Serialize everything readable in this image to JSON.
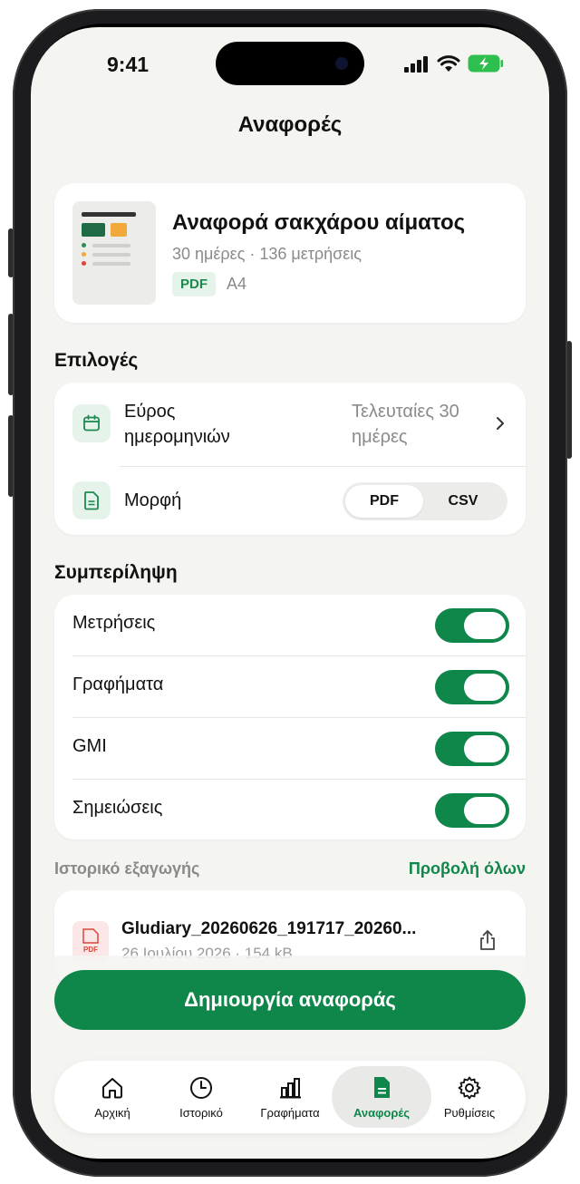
{
  "status_bar": {
    "time": "9:41"
  },
  "header": {
    "title": "Αναφορές"
  },
  "report": {
    "title": "Αναφορά σακχάρου αίματος",
    "meta": "30 ημέρες · 136 μετρήσεις",
    "format_badge": "PDF",
    "paper_size": "A4"
  },
  "options": {
    "heading": "Επιλογές",
    "date_range": {
      "label": "Εύρος ημερομηνιών",
      "value": "Τελευταίες 30 ημέρες",
      "icon": "calendar-icon"
    },
    "format": {
      "label": "Μορφή",
      "icon": "document-icon",
      "options": [
        "PDF",
        "CSV"
      ],
      "selected": "PDF"
    }
  },
  "include": {
    "heading": "Συμπερίληψη",
    "items": [
      {
        "label": "Μετρήσεις",
        "on": true
      },
      {
        "label": "Γραφήματα",
        "on": true
      },
      {
        "label": "GMI",
        "on": true
      },
      {
        "label": "Σημειώσεις",
        "on": true
      }
    ]
  },
  "history": {
    "heading": "Ιστορικό εξαγωγής",
    "view_all": "Προβολή όλων",
    "files": [
      {
        "name": "Gludiary_20260626_191717_20260...",
        "meta": "26 Ιουλίου 2026 · 154 kB",
        "type_label": "PDF"
      }
    ]
  },
  "actions": {
    "create": "Δημιουργία αναφοράς"
  },
  "tabbar": {
    "items": [
      {
        "label": "Αρχική",
        "icon": "home-icon"
      },
      {
        "label": "Ιστορικό",
        "icon": "clock-icon"
      },
      {
        "label": "Γραφήματα",
        "icon": "bar-chart-icon"
      },
      {
        "label": "Αναφορές",
        "icon": "report-icon"
      },
      {
        "label": "Ρυθμίσεις",
        "icon": "gear-icon"
      }
    ],
    "active": "Αναφορές"
  },
  "colors": {
    "accent": "#0f874a",
    "accent_soft": "#e5f3ea",
    "background": "#f4f4f1"
  }
}
